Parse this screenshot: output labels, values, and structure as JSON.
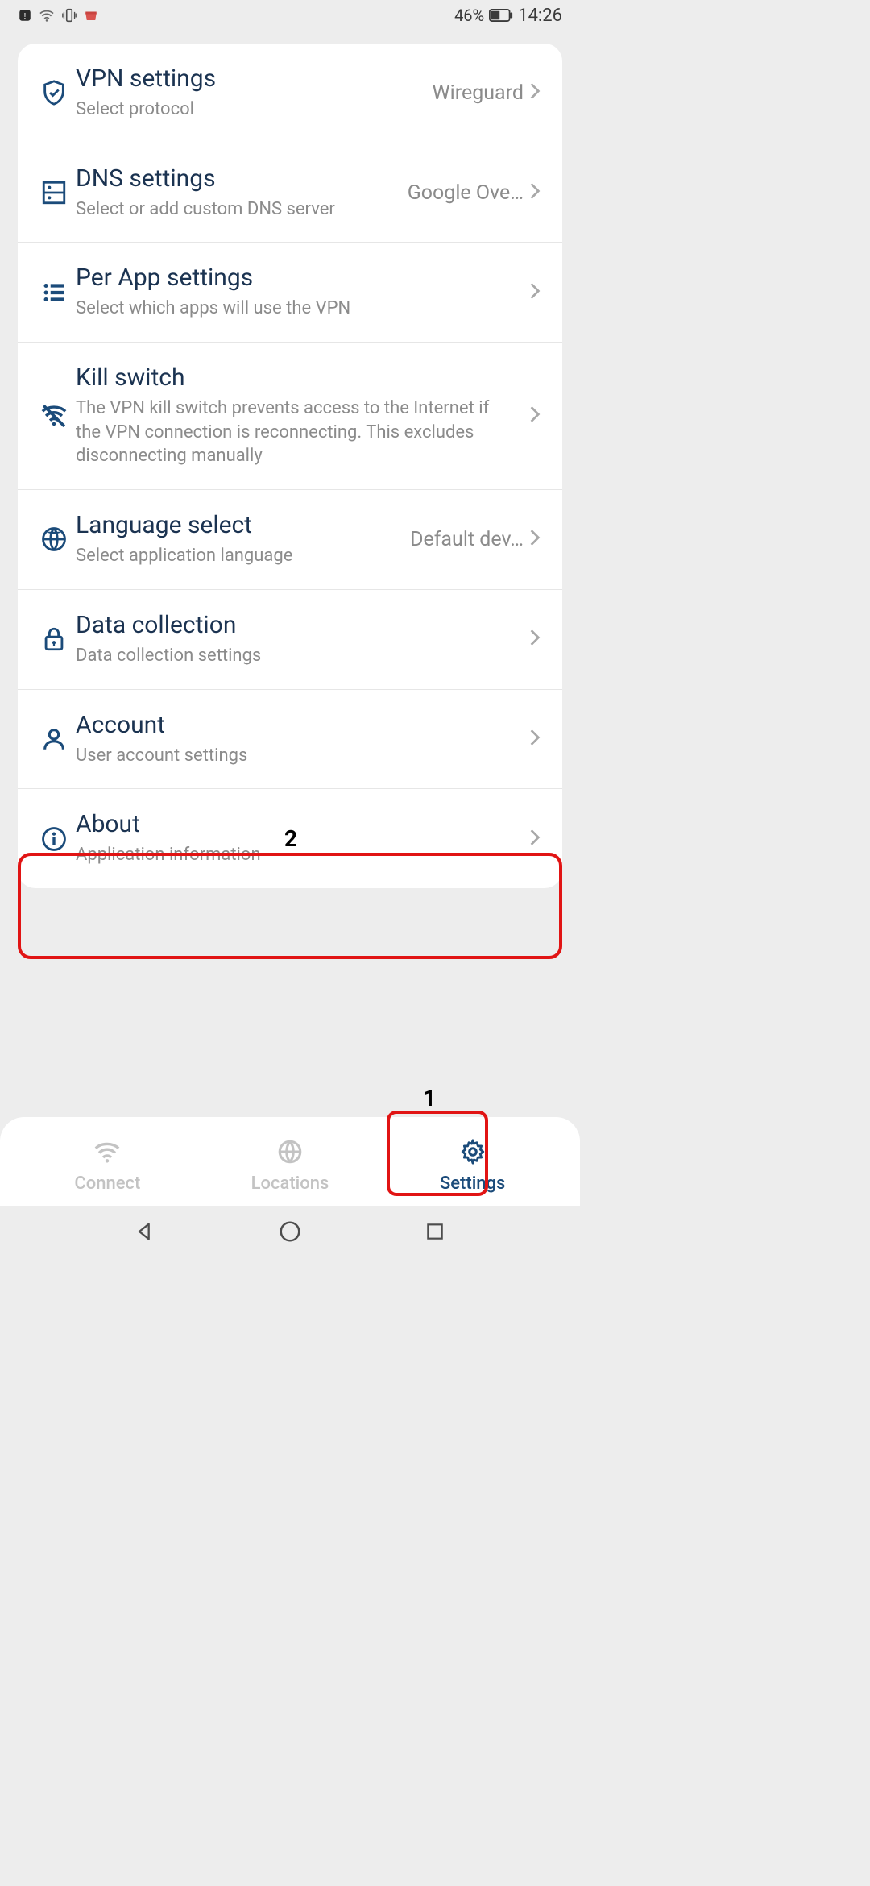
{
  "status": {
    "battery_pct": "46%",
    "time": "14:26"
  },
  "settings": [
    {
      "id": "vpn",
      "icon": "shield-check-icon",
      "title": "VPN settings",
      "subtitle": "Select protocol",
      "value": "Wireguard"
    },
    {
      "id": "dns",
      "icon": "server-icon",
      "title": "DNS settings",
      "subtitle": "Select or add custom DNS server",
      "value": "Google Ove…"
    },
    {
      "id": "perapp",
      "icon": "list-icon",
      "title": "Per App settings",
      "subtitle": "Select which apps will use the VPN",
      "value": ""
    },
    {
      "id": "kill",
      "icon": "wifi-off-icon",
      "title": "Kill switch",
      "subtitle": "The VPN kill switch prevents access to the Internet if the VPN connection is reconnecting. This excludes disconnecting manually",
      "value": ""
    },
    {
      "id": "lang",
      "icon": "globe-icon",
      "title": "Language select",
      "subtitle": "Select application language",
      "value": "Default dev…"
    },
    {
      "id": "data",
      "icon": "lock-icon",
      "title": "Data collection",
      "subtitle": "Data collection settings",
      "value": ""
    },
    {
      "id": "acct",
      "icon": "person-icon",
      "title": "Account",
      "subtitle": "User account settings",
      "value": ""
    },
    {
      "id": "about",
      "icon": "info-icon",
      "title": "About",
      "subtitle": "Application information",
      "value": ""
    }
  ],
  "nav": {
    "connect": "Connect",
    "locations": "Locations",
    "settings": "Settings"
  },
  "annotations": {
    "label1": "1",
    "label2": "2"
  }
}
